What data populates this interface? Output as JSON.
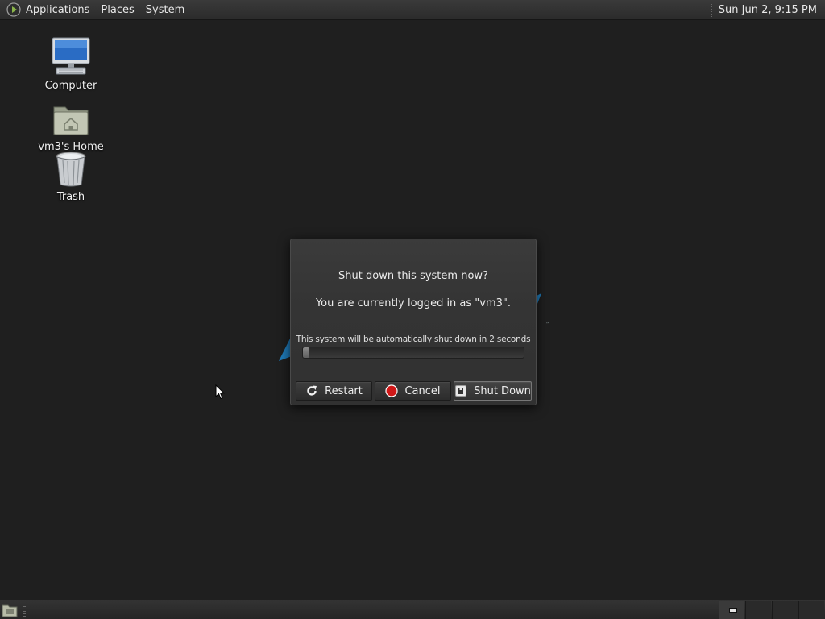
{
  "top_panel": {
    "menus": [
      "Applications",
      "Places",
      "System"
    ],
    "clock": "Sun Jun  2,  9:15 PM"
  },
  "desktop": {
    "icons": [
      {
        "label": "Computer",
        "icon": "computer-icon"
      },
      {
        "label": "vm3's Home",
        "icon": "home-folder-icon"
      },
      {
        "label": "Trash",
        "icon": "trash-icon"
      }
    ]
  },
  "dialog": {
    "heading": "Shut down this system now?",
    "subtext": "You are currently logged in as \"vm3\".",
    "progress_label": "This system will be automatically shut down in 2 seconds",
    "progress_fraction": 0.03,
    "buttons": {
      "restart": "Restart",
      "cancel": "Cancel",
      "shutdown": "Shut Down"
    }
  },
  "bottom_panel": {
    "workspaces": 4,
    "active_workspace": 1
  },
  "colors": {
    "desktop_bg": "#1f1f1f",
    "accent_blue": "#1f7ab8",
    "cancel_red": "#d01818"
  }
}
